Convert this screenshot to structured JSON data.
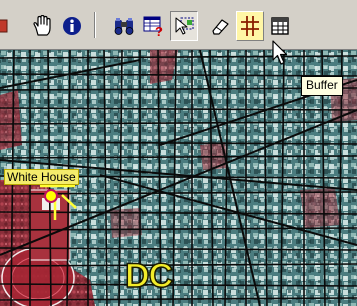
{
  "toolbar": {
    "buttons": [
      {
        "name": "pan",
        "icon": "hand-icon"
      },
      {
        "name": "identify",
        "icon": "info-icon"
      },
      {
        "name": "find",
        "icon": "binoculars-icon"
      },
      {
        "name": "query",
        "icon": "query-table-icon"
      },
      {
        "name": "select",
        "icon": "select-arrow-icon"
      },
      {
        "name": "clear",
        "icon": "eraser-icon"
      },
      {
        "name": "buffer",
        "icon": "buffer-grid-icon"
      },
      {
        "name": "table",
        "icon": "table-icon"
      }
    ],
    "active_button": "buffer"
  },
  "tooltip": {
    "text": "Buffer"
  },
  "map": {
    "labels": {
      "white_house": "White House",
      "dc": "DC"
    },
    "colors": {
      "imagery_base": "#3f6f72",
      "roads": "#0a0a0a",
      "highlight": "#ffff00",
      "buffer_fill": "#b3202e",
      "label_bg": "#f4ec6c"
    }
  }
}
